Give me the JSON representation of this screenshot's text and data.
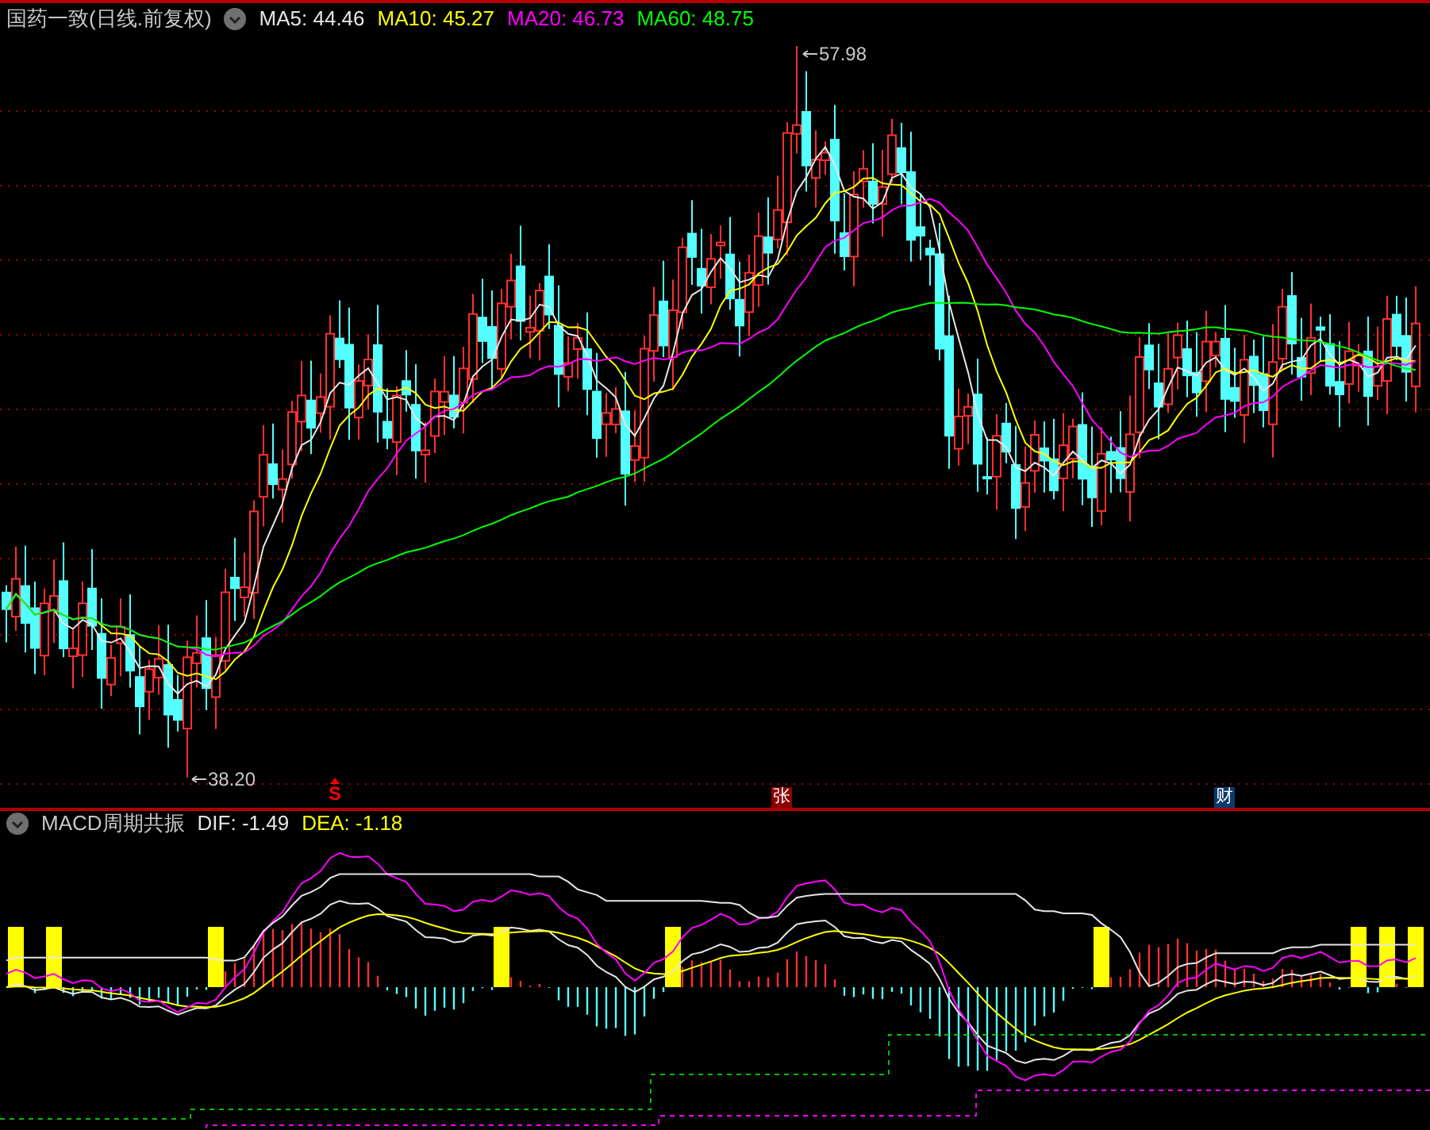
{
  "header": {
    "title": "国药一致(日线.前复权)",
    "indicators": [
      {
        "label": "MA5: 44.46",
        "color": "#e6e6e6"
      },
      {
        "label": "MA10: 45.27",
        "color": "#ffff00"
      },
      {
        "label": "MA20: 46.73",
        "color": "#ff00ff"
      },
      {
        "label": "MA60: 48.75",
        "color": "#00ff00"
      }
    ]
  },
  "price_chart": {
    "high_label": "57.98",
    "low_label": "38.20",
    "markers": [
      {
        "kind": "signal",
        "text": "S"
      },
      {
        "kind": "badge",
        "text": "张",
        "color": "#8b0000"
      },
      {
        "kind": "badge",
        "text": "财",
        "color": "#0a3a6e"
      }
    ]
  },
  "macd_panel": {
    "title": "MACD周期共振",
    "values": [
      {
        "label": "DIF: -1.49",
        "color": "#e6e6e6"
      },
      {
        "label": "DEA: -1.18",
        "color": "#ffff00"
      }
    ]
  }
}
